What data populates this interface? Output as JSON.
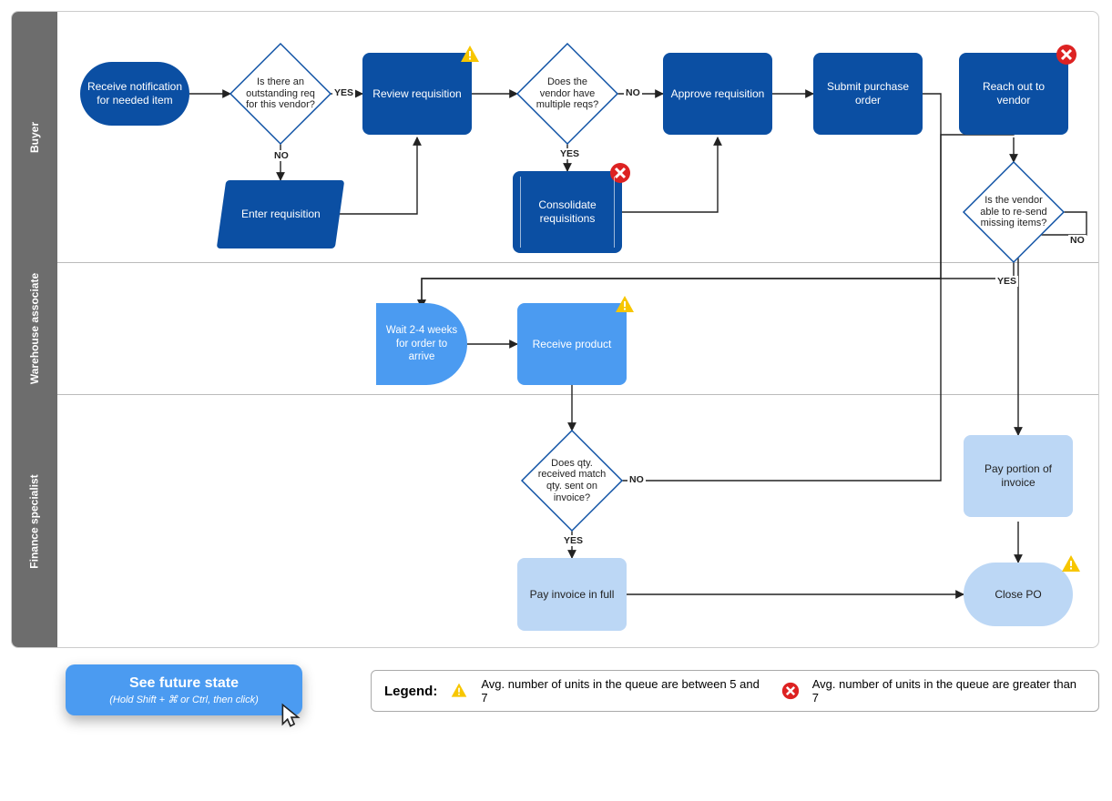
{
  "lanes": {
    "buyer": "Buyer",
    "warehouse": "Warehouse associate",
    "finance": "Finance specialist"
  },
  "nodes": {
    "receive_notif": "Receive notification for needed item",
    "dec_outstanding": "Is there an outstanding req for this vendor?",
    "enter_req": "Enter requisition",
    "review_req": "Review requisition",
    "dec_multi": "Does the vendor have multiple reqs?",
    "consolidate": "Consolidate requisitions",
    "approve_req": "Approve requisition",
    "submit_po": "Submit purchase order",
    "reach_vendor": "Reach out to vendor",
    "dec_resend": "Is the vendor able to re-send missing items?",
    "wait_delay": "Wait 2-4 weeks for order to arrive",
    "receive_prod": "Receive product",
    "dec_qty": "Does qty. received match qty. sent on invoice?",
    "pay_full": "Pay invoice in full",
    "pay_portion": "Pay portion of invoice",
    "close_po": "Close PO"
  },
  "edge_labels": {
    "yes": "YES",
    "no": "NO"
  },
  "cta": {
    "title": "See future state",
    "subtitle": "(Hold Shift + ⌘ or Ctrl, then click)"
  },
  "legend": {
    "title": "Legend:",
    "warn_text": "Avg. number of units in the queue are between 5 and  7",
    "err_text": "Avg. number of units in the queue are greater than 7"
  },
  "icons": {
    "warn": "warning-icon",
    "err": "error-icon",
    "cursor": "cursor-icon"
  }
}
